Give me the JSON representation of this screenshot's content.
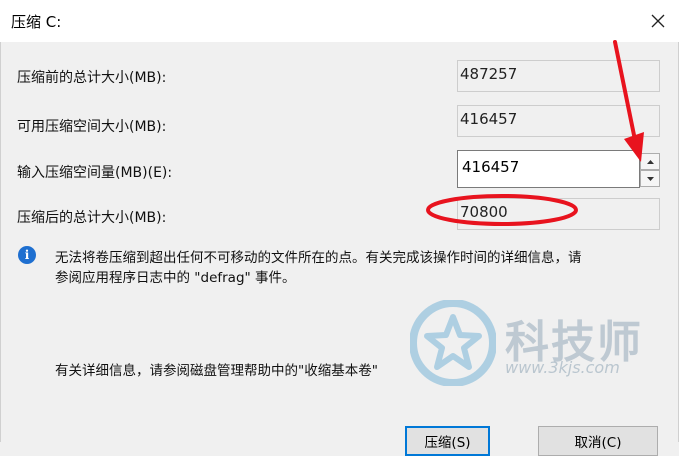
{
  "dialog": {
    "title": "压缩 C:"
  },
  "fields": {
    "total_before_label": "压缩前的总计大小(MB):",
    "total_before_value": "487257",
    "available_label": "可用压缩空间大小(MB):",
    "available_value": "416457",
    "amount_label": "输入压缩空间量(MB)(E):",
    "amount_value": "416457",
    "total_after_label": "压缩后的总计大小(MB):",
    "total_after_value": "70800"
  },
  "info": {
    "line1": "无法将卷压缩到超出任何不可移动的文件所在的点。有关完成该操作时间的详细信息，请",
    "line2": "参阅应用程序日志中的 \"defrag\" 事件。",
    "help_line": "有关详细信息，请参阅磁盘管理帮助中的\"收缩基本卷\""
  },
  "buttons": {
    "shrink": "压缩(S)",
    "cancel": "取消(C)"
  },
  "watermark": {
    "title": "科技师",
    "url": "www.3kjs.com"
  },
  "colors": {
    "annotation": "#e8131e",
    "info_icon": "#1e6fd0"
  },
  "icons": [
    "close-icon",
    "spin-up-icon",
    "spin-down-icon",
    "info-icon",
    "watermark-star-logo"
  ]
}
